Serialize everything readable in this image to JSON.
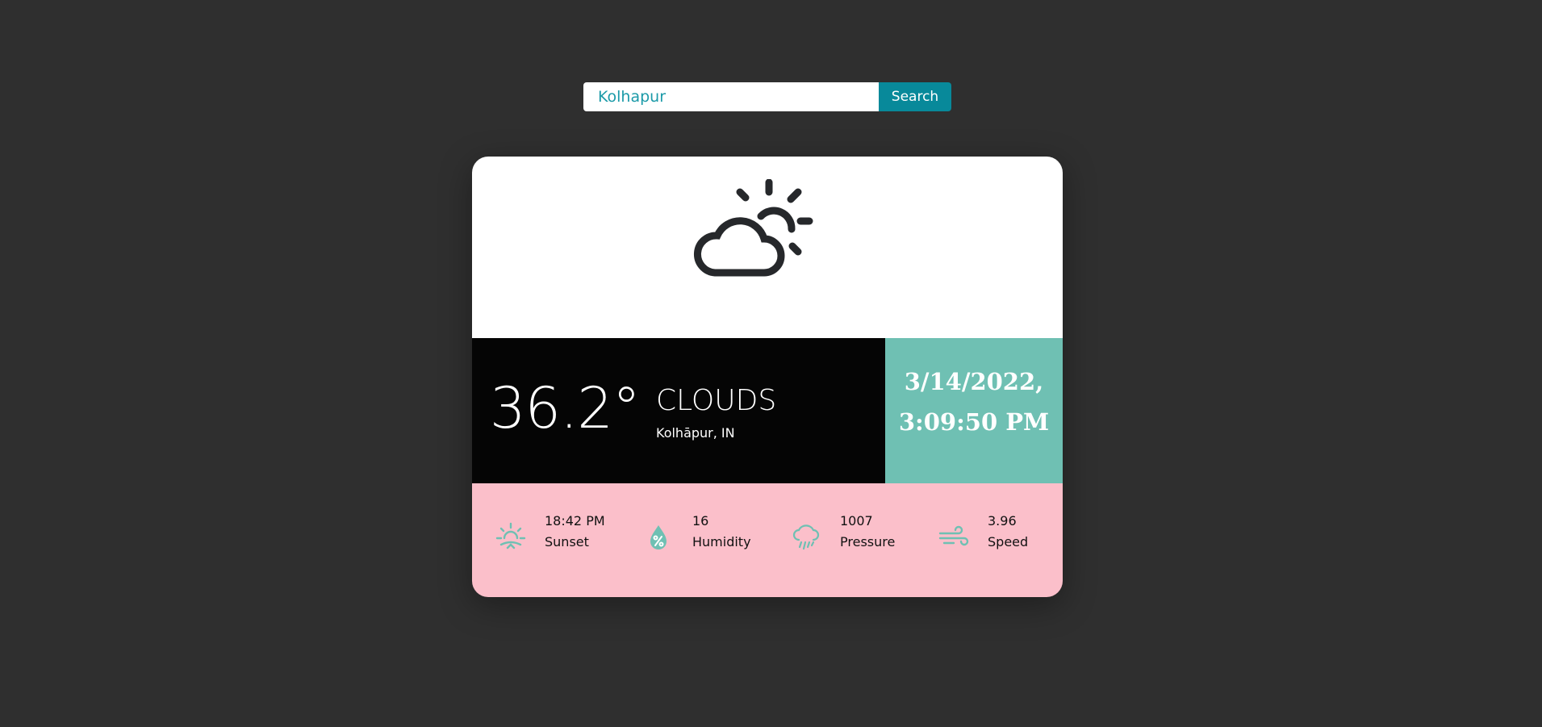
{
  "search": {
    "value": "Kolhapur",
    "button_label": "Search"
  },
  "weather": {
    "icon": "cloudy-sun-icon",
    "temperature": "36.2°",
    "condition": "CLOUDS",
    "location": "Kolhāpur, IN",
    "date": "3/14/2022,",
    "time": "3:09:50 PM"
  },
  "stats": [
    {
      "icon": "sunset-icon",
      "value": "18:42 PM",
      "label": "Sunset"
    },
    {
      "icon": "humidity-icon",
      "value": "16",
      "label": "Humidity"
    },
    {
      "icon": "pressure-icon",
      "value": "1007",
      "label": "Pressure"
    },
    {
      "icon": "wind-icon",
      "value": "3.96",
      "label": "Speed"
    }
  ],
  "colors": {
    "background": "#2f2f2f",
    "accent_teal": "#08899a",
    "datetime_band": "#6fc0b3",
    "stats_band": "#fbbfca",
    "info_band": "#050505",
    "stat_icon": "#6fc0b3"
  }
}
